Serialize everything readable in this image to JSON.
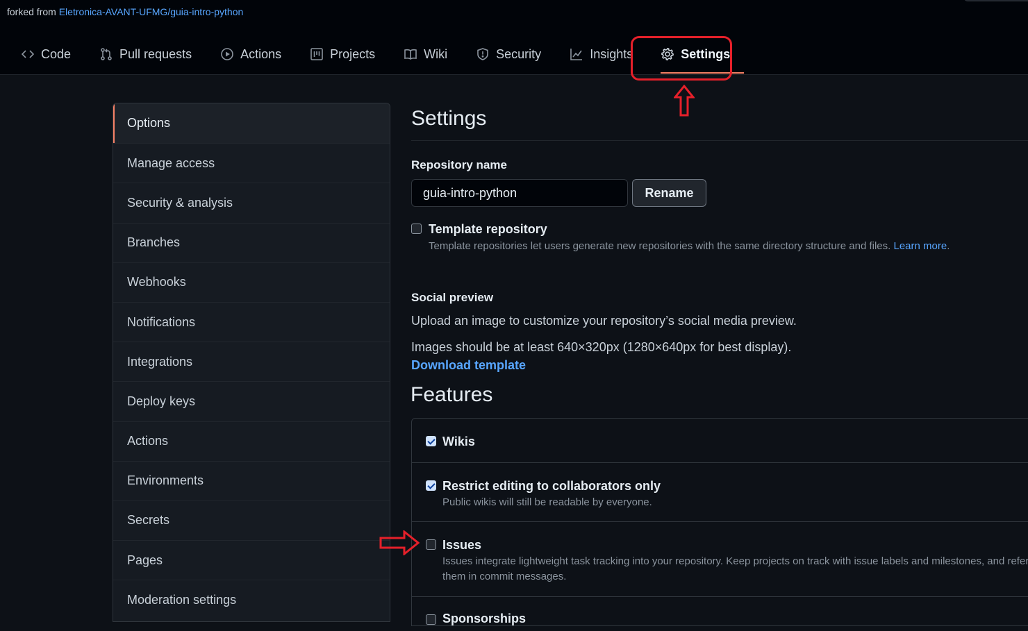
{
  "header": {
    "forked_prefix": "forked from",
    "forked_repo": "Eletronica-AVANT-UFMG/guia-intro-python"
  },
  "tabs": [
    {
      "label": "Code",
      "icon": "code-icon"
    },
    {
      "label": "Pull requests",
      "icon": "pull-request-icon"
    },
    {
      "label": "Actions",
      "icon": "play-icon"
    },
    {
      "label": "Projects",
      "icon": "project-icon"
    },
    {
      "label": "Wiki",
      "icon": "book-icon"
    },
    {
      "label": "Security",
      "icon": "shield-icon"
    },
    {
      "label": "Insights",
      "icon": "graph-icon"
    },
    {
      "label": "Settings",
      "icon": "gear-icon",
      "active": true
    }
  ],
  "sidebar": {
    "items": [
      {
        "label": "Options"
      },
      {
        "label": "Manage access"
      },
      {
        "label": "Security & analysis"
      },
      {
        "label": "Branches"
      },
      {
        "label": "Webhooks"
      },
      {
        "label": "Notifications"
      },
      {
        "label": "Integrations"
      },
      {
        "label": "Deploy keys"
      },
      {
        "label": "Actions"
      },
      {
        "label": "Environments"
      },
      {
        "label": "Secrets"
      },
      {
        "label": "Pages"
      },
      {
        "label": "Moderation settings"
      }
    ]
  },
  "main": {
    "title": "Settings",
    "repo_name_label": "Repository name",
    "repo_name_value": "guia-intro-python",
    "rename_label": "Rename",
    "template": {
      "label": "Template repository",
      "description": "Template repositories let users generate new repositories with the same directory structure and files.",
      "learn_more": "Learn more",
      "suffix": ".",
      "checked": false
    },
    "social": {
      "title": "Social preview",
      "line1": "Upload an image to customize your repository’s social media preview.",
      "line2": "Images should be at least 640×320px (1280×640px for best display).",
      "download": "Download template"
    },
    "features_title": "Features",
    "features": {
      "wikis": {
        "label": "Wikis",
        "checked": true
      },
      "restrict": {
        "label": "Restrict editing to collaborators only",
        "description": "Public wikis will still be readable by everyone.",
        "checked": true
      },
      "issues": {
        "label": "Issues",
        "description_line1": "Issues integrate lightweight task tracking into your repository. Keep projects on track with issue labels and milestones, and refer",
        "description_line2": "them in commit messages.",
        "checked": false
      },
      "sponsorships": {
        "label": "Sponsorships",
        "checked": false
      }
    }
  },
  "colors": {
    "accent_underline": "#f78166",
    "link": "#58a6ff",
    "annotation_red": "#e5202a"
  }
}
